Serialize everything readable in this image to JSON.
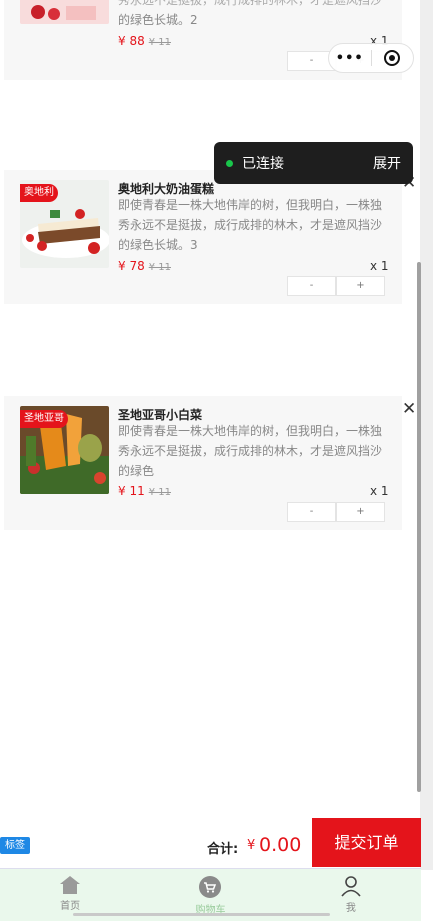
{
  "capsule": {
    "more": "•••",
    "close_icon": "target-close-icon"
  },
  "toast": {
    "status": "已连接",
    "action": "展开",
    "dot_color": "#19c64b"
  },
  "cart_items": [
    {
      "tag": "",
      "title": "",
      "description_tail": "秀永远不是挺拔，成行成排的林木，才是遮风挡沙",
      "description_last": "的绿色长城。2",
      "price": "¥ 88",
      "original_price": "¥ 11",
      "qty": "x 1",
      "minus": "-",
      "plus": "+"
    },
    {
      "tag": "奥地利",
      "title": "奥地利大奶油蛋糕",
      "description": "即使青春是一株大地伟岸的树，但我明白，一株独秀永远不是挺拔，成行成排的林木，才是遮风挡沙的绿色长城。3",
      "price": "¥ 78",
      "original_price": "¥ 11",
      "qty": "x 1",
      "minus": "-",
      "plus": "+"
    },
    {
      "tag": "圣地亚哥",
      "title": "圣地亚哥小白菜",
      "description": "即使青春是一株大地伟岸的树，但我明白，一株独秀永远不是挺拔，成行成排的林木，才是遮风挡沙的绿色",
      "price": "¥ 11",
      "original_price": "¥ 11",
      "qty": "x 1",
      "minus": "-",
      "plus": "+"
    }
  ],
  "footer": {
    "badge": "标签",
    "total_label": "合计:",
    "currency": "¥",
    "total": "0.00",
    "submit": "提交订单"
  },
  "tabs": [
    {
      "label": "首页",
      "icon": "home-icon",
      "active": false
    },
    {
      "label": "购物车",
      "icon": "cart-icon",
      "active": true
    },
    {
      "label": "我",
      "icon": "user-icon",
      "active": false
    }
  ],
  "colors": {
    "accent": "#e4141b",
    "tab_active": "#9acc9c",
    "tabbar_bg": "#eaf8ec",
    "badge": "#1e88e5"
  }
}
